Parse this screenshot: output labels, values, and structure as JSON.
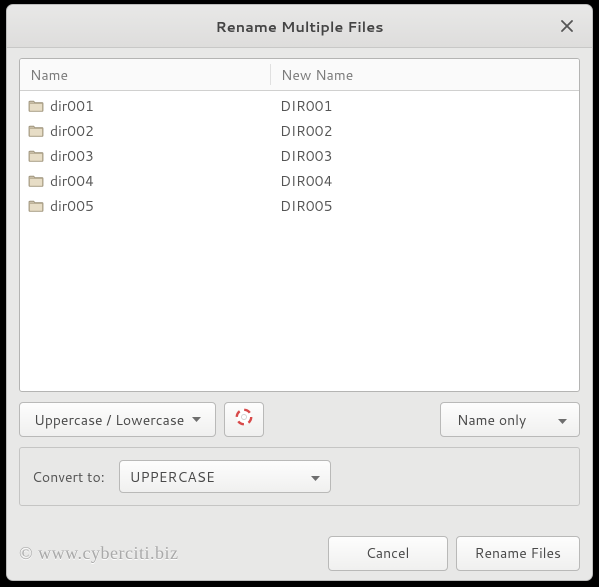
{
  "window": {
    "title": "Rename Multiple Files"
  },
  "columns": {
    "name": "Name",
    "new_name": "New Name"
  },
  "rows": [
    {
      "name": "dir001",
      "new_name": "DIR001"
    },
    {
      "name": "dir002",
      "new_name": "DIR002"
    },
    {
      "name": "dir003",
      "new_name": "DIR003"
    },
    {
      "name": "dir004",
      "new_name": "DIR004"
    },
    {
      "name": "dir005",
      "new_name": "DIR005"
    }
  ],
  "controls": {
    "mode_label": "Uppercase / Lowercase",
    "scope_label": "Name only"
  },
  "convert": {
    "label": "Convert to:",
    "value": "UPPERCASE"
  },
  "footer": {
    "watermark": "© www.cyberciti.biz",
    "cancel": "Cancel",
    "rename": "Rename Files"
  }
}
